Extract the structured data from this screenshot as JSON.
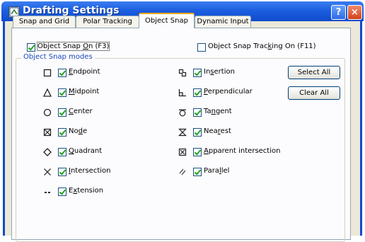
{
  "window": {
    "title": "Drafting Settings",
    "help_glyph": "?",
    "close_glyph": "×"
  },
  "tabs": [
    {
      "label": "Snap and Grid",
      "active": false
    },
    {
      "label": "Polar Tracking",
      "active": false
    },
    {
      "label": "Object Snap",
      "active": true
    },
    {
      "label": "Dynamic Input",
      "active": false
    }
  ],
  "object_snap_on": {
    "prefix": "Object Snap ",
    "accel": "O",
    "suffix": "n (F3)",
    "checked": true
  },
  "object_snap_tracking_on": {
    "prefix": "Object Snap Trac",
    "accel": "k",
    "suffix": "ing On (F11)",
    "checked": false
  },
  "modes_group": {
    "title": "Object Snap modes"
  },
  "modes_left": [
    {
      "pre": "",
      "accel": "E",
      "post": "ndpoint",
      "checked": true,
      "icon": "endpoint-marker-icon"
    },
    {
      "pre": "",
      "accel": "M",
      "post": "idpoint",
      "checked": true,
      "icon": "midpoint-marker-icon"
    },
    {
      "pre": "",
      "accel": "C",
      "post": "enter",
      "checked": true,
      "icon": "center-marker-icon"
    },
    {
      "pre": "No",
      "accel": "d",
      "post": "e",
      "checked": true,
      "icon": "node-marker-icon"
    },
    {
      "pre": "",
      "accel": "Q",
      "post": "uadrant",
      "checked": true,
      "icon": "quadrant-marker-icon"
    },
    {
      "pre": "",
      "accel": "I",
      "post": "ntersection",
      "checked": true,
      "icon": "intersection-marker-icon"
    },
    {
      "pre": "E",
      "accel": "x",
      "post": "tension",
      "checked": true,
      "icon": "extension-marker-icon"
    }
  ],
  "modes_right": [
    {
      "pre": "In",
      "accel": "s",
      "post": "ertion",
      "checked": true,
      "icon": "insertion-marker-icon"
    },
    {
      "pre": "",
      "accel": "P",
      "post": "erpendicular",
      "checked": true,
      "icon": "perpendicular-marker-icon"
    },
    {
      "pre": "Ta",
      "accel": "n",
      "post": "gent",
      "checked": true,
      "icon": "tangent-marker-icon"
    },
    {
      "pre": "Nea",
      "accel": "r",
      "post": "est",
      "checked": true,
      "icon": "nearest-marker-icon"
    },
    {
      "pre": "",
      "accel": "A",
      "post": "pparent intersection",
      "checked": true,
      "icon": "apparent-intersection-marker-icon"
    },
    {
      "pre": "Para",
      "accel": "l",
      "post": "lel",
      "checked": true,
      "icon": "parallel-marker-icon"
    }
  ],
  "buttons": {
    "select_all": "Select All",
    "clear_all": "Clear All"
  }
}
